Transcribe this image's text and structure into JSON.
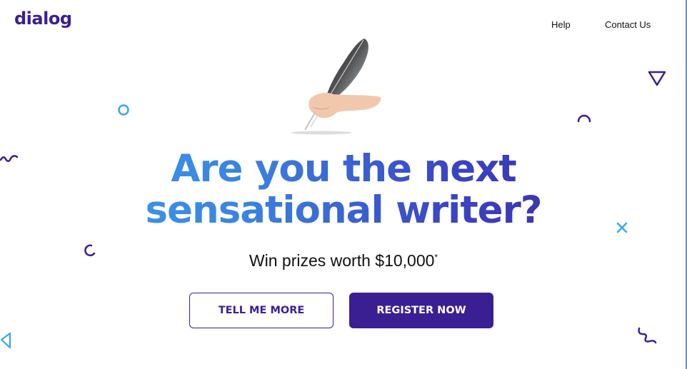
{
  "header": {
    "logo": "dialog",
    "nav": [
      {
        "label": "Help"
      },
      {
        "label": "Contact Us"
      }
    ]
  },
  "hero": {
    "image_icon": "quill-pen-hand-icon",
    "headline_line1": "Are you the next",
    "headline_line2": "sensational writer?",
    "subline": "Win prizes worth $10,000",
    "subline_mark": "*",
    "buttons": {
      "secondary": "TELL ME MORE",
      "primary": "REGISTER NOW"
    }
  },
  "colors": {
    "brand": "#3a1f93",
    "accent": "#3ea3f0"
  }
}
